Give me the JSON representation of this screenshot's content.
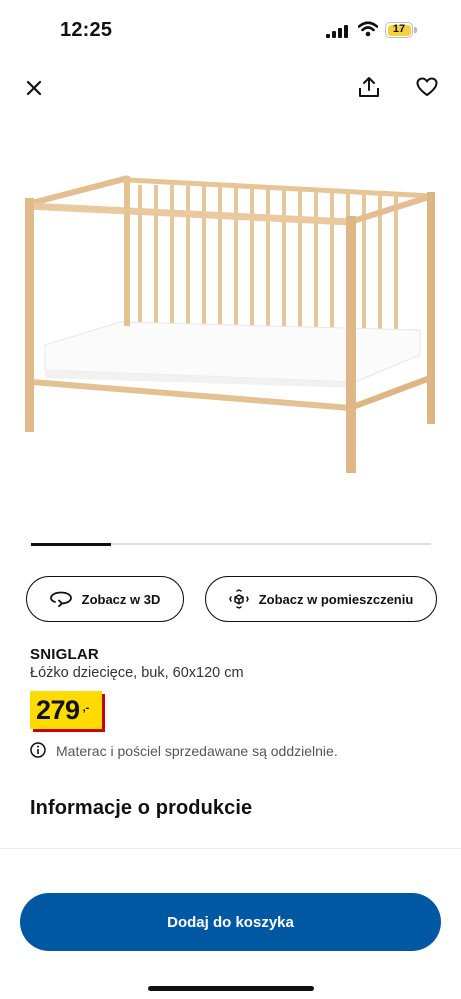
{
  "status_bar": {
    "time": "12:25",
    "battery": "17"
  },
  "nav": {
    "close_icon": "close-icon",
    "share_icon": "share-icon",
    "favorite_icon": "heart-icon"
  },
  "gallery": {
    "progress": 0.2
  },
  "actions": {
    "view_3d": {
      "label": "Zobacz w 3D",
      "icon": "rotate-icon"
    },
    "view_in_room": {
      "label": "Zobacz w pomieszczeniu",
      "icon": "ar-cube-icon"
    }
  },
  "product": {
    "name": "SNIGLAR",
    "description": "Łóżko dziecięce, buk, 60x120 cm",
    "price": "279",
    "currency": ",-",
    "notice": "Materac i pościel sprzedawane są oddzielnie."
  },
  "section": {
    "title": "Informacje o produkcie"
  },
  "cart": {
    "label": "Dodaj do koszyka"
  },
  "colors": {
    "accent": "#0058a3",
    "price_bg": "#ffdb00",
    "price_shadow": "#cc0008",
    "wood": "#e8c9a0"
  }
}
